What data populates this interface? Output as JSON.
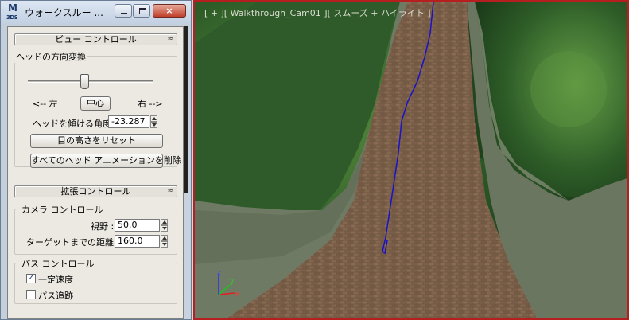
{
  "dialog": {
    "title": "ウォークスルー ...",
    "icon": {
      "name": "3ds-max-icon",
      "text_top": "M",
      "text_bottom": "3DS"
    },
    "window_buttons": {
      "minimize": "minimize-icon",
      "maximize": "maximize-icon",
      "close": "×"
    }
  },
  "view_control": {
    "header": "ビュー コントロール",
    "collapse_glyph": "≈",
    "head_turn_group": "ヘッドの方向変換",
    "slider": {
      "position": 0.45
    },
    "left_label": "<-- 左",
    "center_button": "中心",
    "right_label": "右 -->",
    "tilt_label": "ヘッドを傾ける角度",
    "tilt_value": "-23.287",
    "reset_eye_button": "目の高さをリセット",
    "delete_anim_button": "すべてのヘッド アニメーションを削除"
  },
  "advanced_control": {
    "header": "拡張コントロール",
    "collapse_glyph": "≈",
    "camera_group": "カメラ コントロール",
    "fov_label": "視野 :",
    "fov_value": "50.0",
    "target_dist_label": "ターゲットまでの距離 :",
    "target_dist_value": "160.0",
    "path_group": "パス コントロール",
    "constant_speed_label": "一定速度",
    "constant_speed_checked": true,
    "follow_path_label": "パス追跡",
    "follow_path_checked": false
  },
  "viewport": {
    "label": "[ + ][ Walkthrough_Cam01 ][ スムーズ + ハイライト ]",
    "border_color": "#b51f1f",
    "path_color": "#1a12c8",
    "axis": {
      "z": "z",
      "x": "x",
      "y": "y"
    },
    "colors": {
      "foliage": "#2d5a26",
      "wall": "#6f7a64",
      "road": "#7a5e48"
    }
  }
}
